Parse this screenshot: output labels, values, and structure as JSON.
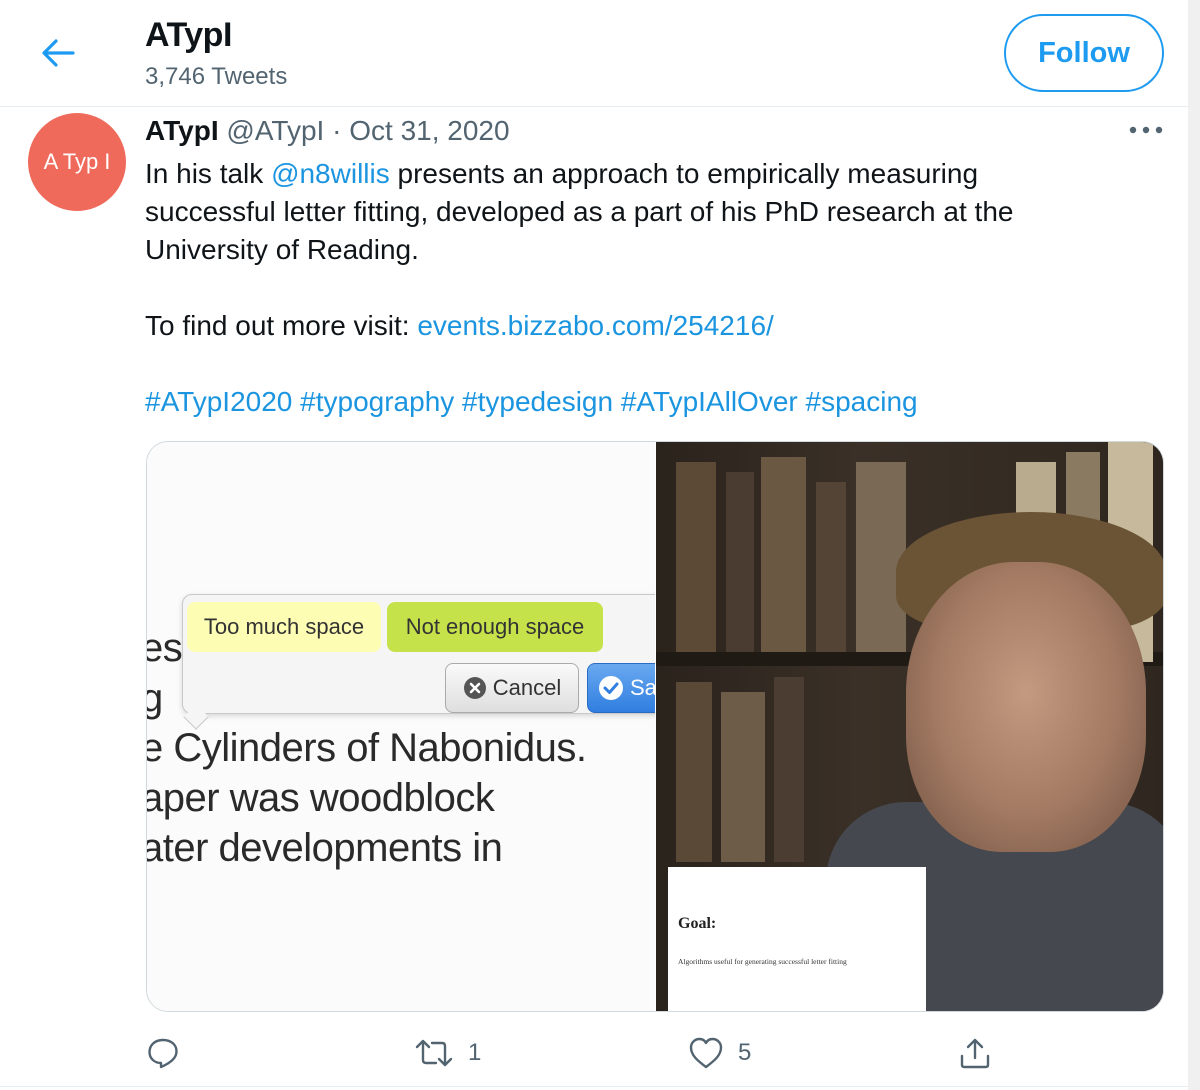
{
  "header": {
    "title": "ATypI",
    "tweet_count": "3,746 Tweets",
    "follow_label": "Follow"
  },
  "tweet": {
    "avatar_text": "A Typ I",
    "author_name": "ATypI",
    "handle": "@ATypI",
    "separator": "·",
    "date": "Oct 31, 2020",
    "line1_pre": "In his talk ",
    "mention": "@n8willis",
    "line1_post": " presents an approach to empirically measuring",
    "line2": "successful letter fitting, developed as a part of his PhD research at the",
    "line3": "University of Reading.",
    "visit_label": "To find out more visit: ",
    "link": "events.bizzabo.com/254216/",
    "hashtags": [
      "#ATypI2020",
      "#typography",
      "#typedesign",
      "#ATypIAllOver",
      "#spacing"
    ]
  },
  "media": {
    "popup": {
      "too_much": "Too much space",
      "not_enough": "Not enough space",
      "cancel": "Cancel",
      "save": "Sa"
    },
    "doc_lines": [
      "es",
      "g",
      "e Cylinders of Nabonidus.",
      "aper was woodblock",
      "ater developments in"
    ],
    "slide": {
      "title": "Goal:",
      "subtitle": "Algorithms useful for generating successful letter fitting"
    }
  },
  "actions": {
    "reply_count": "",
    "retweet_count": "1",
    "like_count": "5"
  },
  "colors": {
    "accent": "#1d9bf0",
    "link": "#1b95e0",
    "avatar": "#ef6a5b",
    "muted": "#536471"
  }
}
